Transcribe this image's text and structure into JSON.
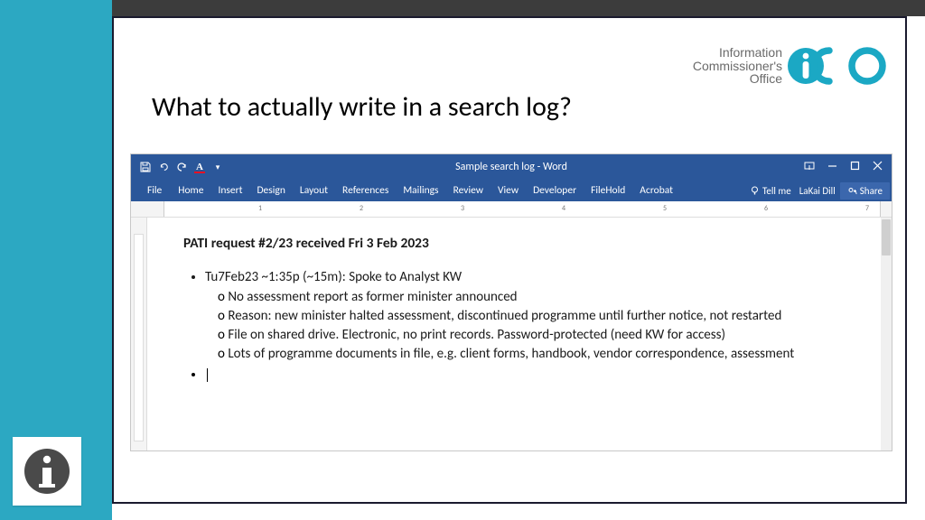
{
  "slide": {
    "title": "What to actually write in a search log?",
    "logo": {
      "line1": "Information",
      "line2": "Commissioner's",
      "line3": "Office"
    }
  },
  "word": {
    "title": "Sample search log - Word",
    "tellme": "Tell me",
    "user": "LaKai Dill",
    "share": "Share",
    "tabs": [
      "File",
      "Home",
      "Insert",
      "Design",
      "Layout",
      "References",
      "Mailings",
      "Review",
      "View",
      "Developer",
      "FileHold",
      "Acrobat"
    ],
    "ruler_nums": [
      "1",
      "2",
      "3",
      "4",
      "5",
      "6",
      "7"
    ]
  },
  "doc": {
    "heading": "PATI request #2/23 received Fri 3 Feb 2023",
    "bullets": [
      {
        "lead": "Tu7Feb23 ~1:35p (~15m): Spoke to Analyst KW",
        "sub": [
          "No assessment report as former minister announced",
          "Reason: new minister halted assessment, discontinued programme until further notice, not restarted",
          "File on shared drive. Electronic, no print records. Password-protected (need KW for access)",
          "Lots of programme documents in file, e.g. client forms, handbook, vendor correspondence, assessment"
        ]
      }
    ]
  }
}
